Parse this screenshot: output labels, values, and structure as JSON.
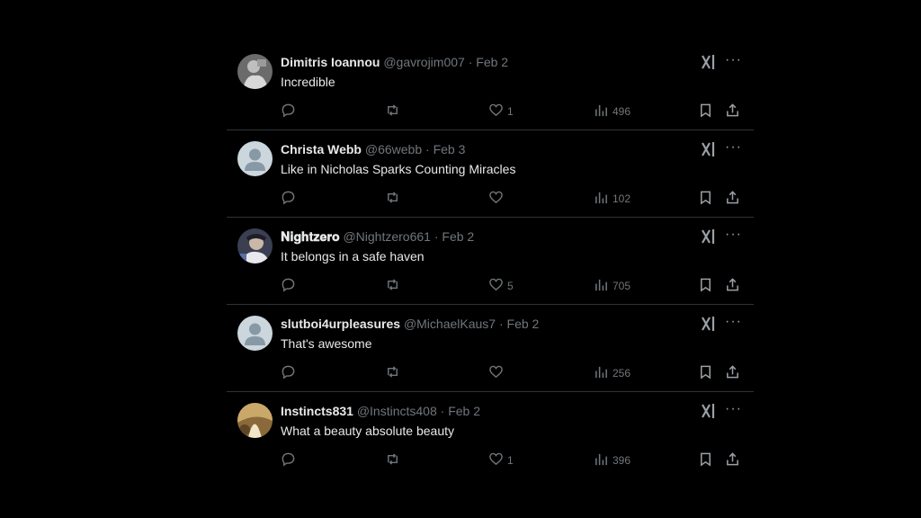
{
  "tweets": [
    {
      "name": "Dimitris Ioannou",
      "handle": "@gavrojim007",
      "sep": "·",
      "date": "Feb 2",
      "text": "Incredible",
      "likes": "1",
      "views": "496",
      "avatar": "photo-grey"
    },
    {
      "name": "Christa Webb",
      "handle": "@66webb",
      "sep": "·",
      "date": "Feb 3",
      "text": "Like in Nicholas Sparks Counting Miracles",
      "likes": "",
      "views": "102",
      "avatar": "default"
    },
    {
      "name": "𝐍𝐢𝐠𝐡𝐭𝐳𝐞𝐫𝐨",
      "handle": "@Nightzero661",
      "sep": "·",
      "date": "Feb 2",
      "text": "It belongs in a safe haven",
      "likes": "5",
      "views": "705",
      "avatar": "photo-blue"
    },
    {
      "name": "slutboi4urpleasures",
      "handle": "@MichaelKaus7",
      "sep": "·",
      "date": "Feb 2",
      "text": "That's awesome",
      "likes": "",
      "views": "256",
      "avatar": "default"
    },
    {
      "name": "Instincts831",
      "handle": "@Instincts408",
      "sep": "·",
      "date": "Feb 2",
      "text": "What a beauty absolute beauty",
      "likes": "1",
      "views": "396",
      "avatar": "photo-gold"
    }
  ],
  "icons": {
    "reply": "reply-icon",
    "retweet": "retweet-icon",
    "like": "heart-icon",
    "views": "analytics-icon",
    "bookmark": "bookmark-icon",
    "share": "share-icon",
    "grok": "grok-icon",
    "more": "more-icon"
  },
  "more_glyph": "···",
  "colors": {
    "background": "#000000",
    "text": "#e7e9ea",
    "muted": "#71767b",
    "divider": "#2f3336",
    "default_avatar": "#ccd6dd"
  }
}
